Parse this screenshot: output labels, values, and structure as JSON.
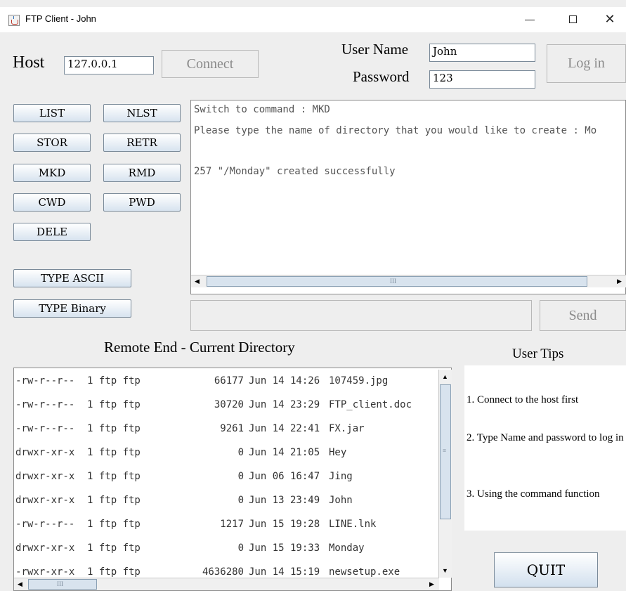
{
  "window": {
    "title": "FTP Client - John",
    "min_glyph": "—",
    "max_glyph": "☐",
    "close_glyph": "✕"
  },
  "connection": {
    "host_label": "Host",
    "host_value": "127.0.0.1",
    "connect_label": "Connect",
    "username_label": "User Name",
    "username_value": "John",
    "password_label": "Password",
    "password_value": "123",
    "login_label": "Log in"
  },
  "commands": {
    "list": "LIST",
    "nlst": "NLST",
    "stor": "STOR",
    "retr": "RETR",
    "mkd": "MKD",
    "rmd": "RMD",
    "cwd": "CWD",
    "pwd": "PWD",
    "dele": "DELE",
    "type_ascii": "TYPE ASCII",
    "type_binary": "TYPE Binary"
  },
  "console": {
    "lines": [
      "Switch to command : MKD",
      "Please type the name of directory that you would like to create : Mo",
      "",
      "257 \"/Monday\" created successfully"
    ],
    "scroll_thumb_glyph": "III",
    "input_value": "",
    "send_label": "Send"
  },
  "remote": {
    "title": "Remote End - Current Directory",
    "scroll_thumb_glyph": "III",
    "rows": [
      {
        "perm": "-rw-r--r--",
        "owner": "1 ftp ftp",
        "size": "66177",
        "date": "Jun 14 14:26",
        "name": "107459.jpg"
      },
      {
        "perm": "-rw-r--r--",
        "owner": "1 ftp ftp",
        "size": "30720",
        "date": "Jun 14 23:29",
        "name": "FTP_client.doc"
      },
      {
        "perm": "-rw-r--r--",
        "owner": "1 ftp ftp",
        "size": "9261",
        "date": "Jun 14 22:41",
        "name": "FX.jar"
      },
      {
        "perm": "drwxr-xr-x",
        "owner": "1 ftp ftp",
        "size": "0",
        "date": "Jun 14 21:05",
        "name": "Hey"
      },
      {
        "perm": "drwxr-xr-x",
        "owner": "1 ftp ftp",
        "size": "0",
        "date": "Jun 06 16:47",
        "name": "Jing"
      },
      {
        "perm": "drwxr-xr-x",
        "owner": "1 ftp ftp",
        "size": "0",
        "date": "Jun 13 23:49",
        "name": "John"
      },
      {
        "perm": "-rw-r--r--",
        "owner": "1 ftp ftp",
        "size": "1217",
        "date": "Jun 15 19:28",
        "name": "LINE.lnk"
      },
      {
        "perm": "drwxr-xr-x",
        "owner": "1 ftp ftp",
        "size": "0",
        "date": "Jun 15 19:33",
        "name": "Monday"
      },
      {
        "perm": "-rwxr-xr-x",
        "owner": "1 ftp ftp",
        "size": "4636280",
        "date": "Jun 14 15:19",
        "name": "newsetup.exe"
      }
    ]
  },
  "tips": {
    "title": "User Tips",
    "items": [
      "1. Connect to the host first",
      "2. Type Name and password to log in",
      "3. Using the command function"
    ]
  },
  "quit_label": "QUIT"
}
